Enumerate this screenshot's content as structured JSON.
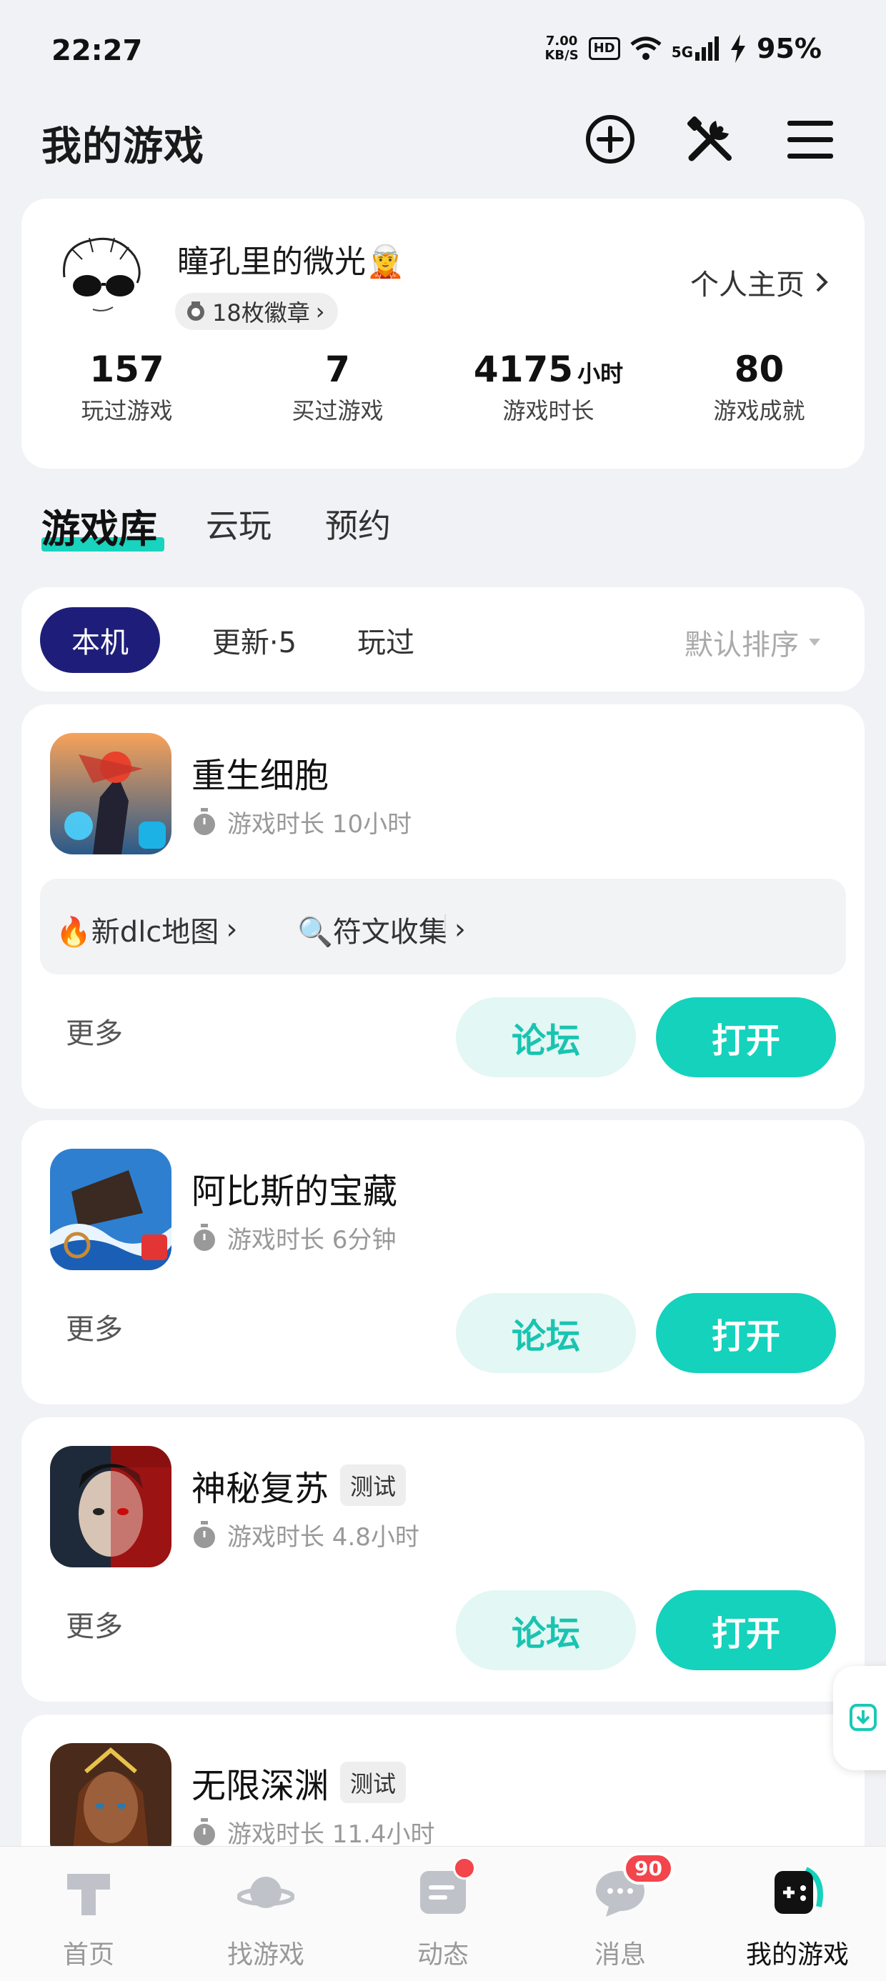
{
  "status_bar": {
    "time": "22:27",
    "net_speed_top": "7.00",
    "net_speed_bottom": "KB/S",
    "hd": "HD",
    "network": "5G",
    "battery": "95%"
  },
  "header": {
    "title": "我的游戏",
    "icons": [
      "add-circle-icon",
      "tools-icon",
      "menu-icon"
    ]
  },
  "profile": {
    "username": "瞳孔里的微光",
    "username_emoji": "🧝",
    "badges_label": "18枚徽章",
    "home_link": "个人主页",
    "stats": [
      {
        "value": "157",
        "unit": "",
        "label": "玩过游戏"
      },
      {
        "value": "7",
        "unit": "",
        "label": "买过游戏"
      },
      {
        "value": "4175",
        "unit": "小时",
        "label": "游戏时长"
      },
      {
        "value": "80",
        "unit": "",
        "label": "游戏成就"
      }
    ]
  },
  "tabs": [
    {
      "label": "游戏库",
      "active": true
    },
    {
      "label": "云玩",
      "active": false
    },
    {
      "label": "预约",
      "active": false
    }
  ],
  "filters": {
    "chips": [
      {
        "label": "本机",
        "active": true
      },
      {
        "label": "更新·5",
        "active": false
      },
      {
        "label": "玩过",
        "active": false
      }
    ],
    "sort": "默认排序"
  },
  "games": [
    {
      "name": "重生细胞",
      "tag": "",
      "playtime": "游戏时长 10小时",
      "quick_links": [
        "🔥新dlc地图",
        "🔍符文收集"
      ],
      "more": "更多",
      "forum": "论坛",
      "open": "打开"
    },
    {
      "name": "阿比斯的宝藏",
      "tag": "",
      "playtime": "游戏时长 6分钟",
      "more": "更多",
      "forum": "论坛",
      "open": "打开"
    },
    {
      "name": "神秘复苏",
      "tag": "测试",
      "playtime": "游戏时长 4.8小时",
      "more": "更多",
      "forum": "论坛",
      "open": "打开"
    },
    {
      "name": "无限深渊",
      "tag": "测试",
      "playtime": "游戏时长 11.4小时"
    }
  ],
  "bottom_nav": [
    {
      "label": "首页",
      "icon": "home-icon"
    },
    {
      "label": "找游戏",
      "icon": "planet-icon"
    },
    {
      "label": "动态",
      "icon": "feed-icon",
      "dot": true
    },
    {
      "label": "消息",
      "icon": "message-icon",
      "badge": "90"
    },
    {
      "label": "我的游戏",
      "icon": "gamepad-icon",
      "active": true
    }
  ],
  "colors": {
    "accent": "#14d2bc",
    "chip_active": "#1e1e7a",
    "badge_red": "#f2454c"
  }
}
